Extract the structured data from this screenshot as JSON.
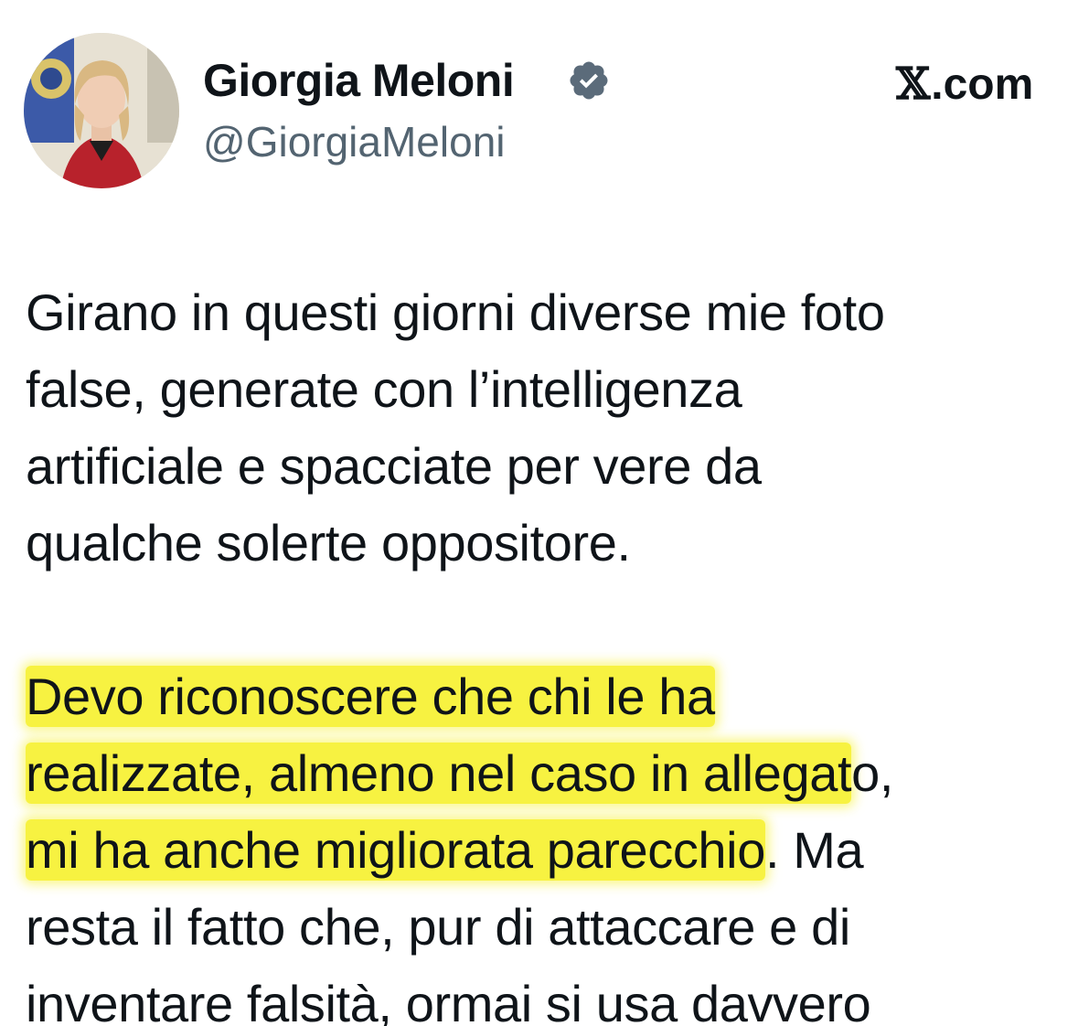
{
  "header": {
    "display_name": "Giorgia Meloni",
    "handle": "@GiorgiaMeloni",
    "brand_x": "𝕏",
    "brand_com": ".com",
    "verified": true,
    "verified_icon": "verified-badge-icon",
    "verified_color": "#5b6b7a"
  },
  "tweet": {
    "paragraph1": [
      "Girano in questi giorni diverse mie foto",
      "false, generate con l’intelligenza",
      "artificiale e spacciate per vere da",
      "qualche solerte oppositore."
    ],
    "paragraph2": {
      "line1_highlighted": "Devo riconoscere che chi le ha",
      "line2_highlighted": "realizzate, almeno nel caso in allegat",
      "line2_rest": "o,",
      "line3_highlighted": "mi ha anche migliorata parecchio",
      "line3_rest": ". Ma",
      "line4": "resta il fatto che, pur di attaccare e di",
      "line5": "inventare falsità, ormai si usa davvero"
    },
    "highlight_color": "#f6f020"
  }
}
